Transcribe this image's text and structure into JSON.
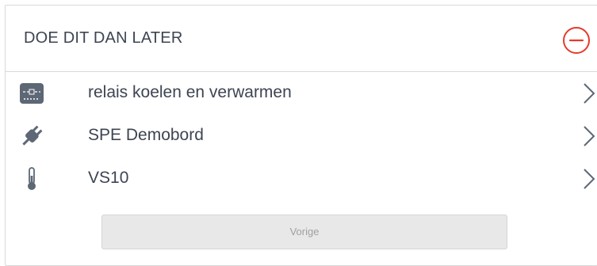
{
  "panel": {
    "title": "DOE DIT DAN LATER",
    "accent_color": "#e53a2b"
  },
  "items": [
    {
      "label": "relais koelen en verwarmen",
      "icon": "relay-module-icon"
    },
    {
      "label": "SPE Demobord",
      "icon": "plug-icon"
    },
    {
      "label": "VS10",
      "icon": "thermometer-icon"
    }
  ],
  "buttons": {
    "previous_label": "Vorige"
  }
}
